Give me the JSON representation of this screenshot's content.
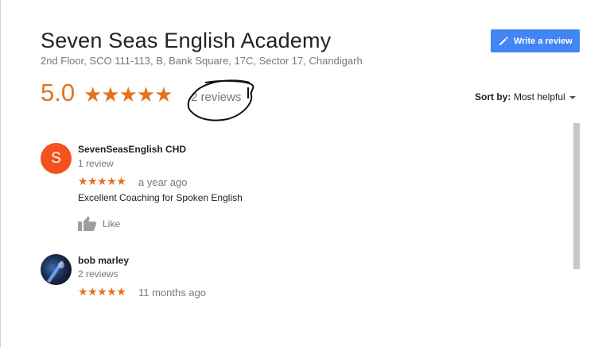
{
  "business": {
    "name": "Seven Seas English Academy",
    "address": "2nd Floor, SCO 111-113, B, Bank Square, 17C, Sector 17, Chandigarh",
    "rating": "5.0",
    "stars": "★★★★★",
    "review_count_label": "2 reviews"
  },
  "toolbar": {
    "write_review_label": "Write a review",
    "sort_by_label": "Sort by:",
    "sort_value": "Most helpful"
  },
  "reviews": [
    {
      "avatar_letter": "S",
      "name": "SevenSeasEnglish CHD",
      "count": "1 review",
      "stars": "★★★★★",
      "time": "a year ago",
      "text": "Excellent Coaching for Spoken English",
      "like_label": "Like"
    },
    {
      "name": "bob marley",
      "count": "2 reviews",
      "stars": "★★★★★",
      "time": "11 months ago"
    }
  ],
  "colors": {
    "accent": "#e7711b",
    "button": "#4285f4",
    "avatar": "#f4511e"
  },
  "icons": {
    "write": "pencil-icon",
    "sort": "caret-down-icon",
    "like": "thumbs-up-icon"
  }
}
